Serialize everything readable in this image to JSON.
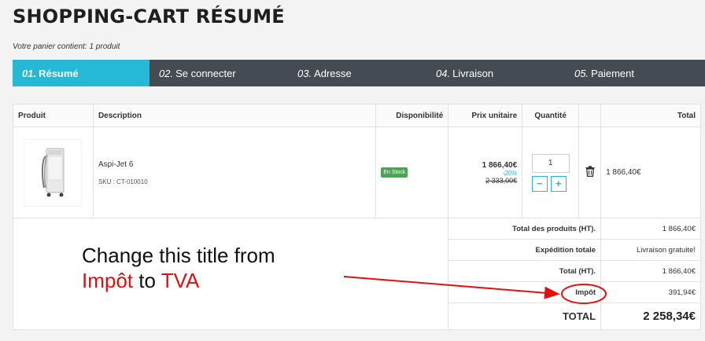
{
  "page": {
    "title": "SHOPPING-CART RÉSUMÉ",
    "cart_count": "Votre panier contient: 1 produit"
  },
  "steps": [
    {
      "num": "01.",
      "label": "Résumé",
      "active": true
    },
    {
      "num": "02.",
      "label": "Se connecter",
      "active": false
    },
    {
      "num": "03.",
      "label": "Adresse",
      "active": false
    },
    {
      "num": "04.",
      "label": "Livraison",
      "active": false
    },
    {
      "num": "05.",
      "label": "Paiement",
      "active": false
    }
  ],
  "table": {
    "headers": {
      "product": "Produit",
      "description": "Description",
      "availability": "Disponibilité",
      "unit_price": "Prix unitaire",
      "quantity": "Quantité",
      "total": "Total"
    },
    "item": {
      "name": "Aspi-Jet 6",
      "sku": "SKU : CT-010010",
      "stock": "En Stock",
      "price": "1 866,40€",
      "discount": "-20%",
      "old_price": "2 333,00€",
      "quantity": "1",
      "minus": "−",
      "plus": "+",
      "total": "1 866,40€"
    }
  },
  "summary": {
    "products_label": "Total des produits (HT).",
    "products_value": "1 866,40€",
    "shipping_label": "Expédition totale",
    "shipping_value": "Livraison gratuite!",
    "total_ht_label": "Total (HT).",
    "total_ht_value": "1 866,40€",
    "tax_label": "Impôt",
    "tax_value": "391,94€",
    "total_label": "TOTAL",
    "total_value": "2 258,34€"
  },
  "annotation": {
    "line1": "Change this title from",
    "word_from": "Impôt",
    "word_to_join": " to ",
    "word_to": "TVA"
  },
  "colors": {
    "accent": "#25b9d7",
    "steps_bg": "#444b52",
    "stock": "#46a74e",
    "annotation": "#e01010"
  },
  "icons": {
    "delete": "trash-icon"
  }
}
